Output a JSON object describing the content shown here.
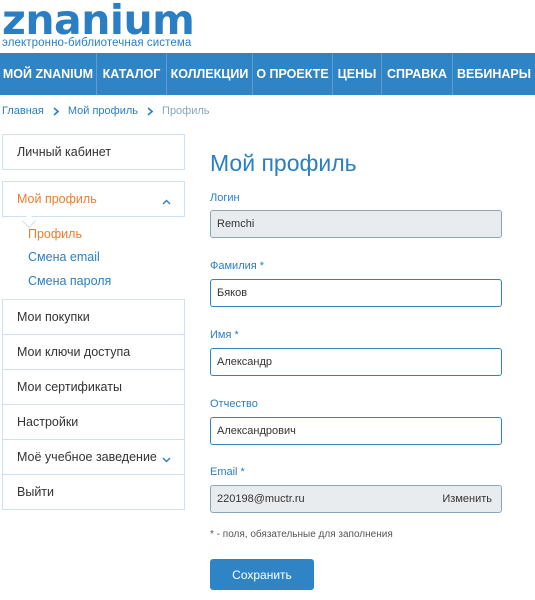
{
  "logo": {
    "word": "znanium",
    "subtitle": "электронно-библиотечная система"
  },
  "nav": {
    "items": [
      {
        "label": "МОЙ ZNANIUM"
      },
      {
        "label": "КАТАЛОГ"
      },
      {
        "label": "КОЛЛЕКЦИИ"
      },
      {
        "label": "О ПРОЕКТЕ"
      },
      {
        "label": "ЦЕНЫ"
      },
      {
        "label": "СПРАВКА"
      },
      {
        "label": "ВЕБИНАРЫ"
      }
    ]
  },
  "breadcrumb": {
    "items": [
      "Главная",
      "Мой профиль",
      "Профиль"
    ]
  },
  "sidebar": {
    "cabinet": "Личный кабинет",
    "profile": "Мой профиль",
    "profile_sub": [
      "Профиль",
      "Смена email",
      "Смена пароля"
    ],
    "items": [
      "Мои покупки",
      "Мои ключи доступа",
      "Мои сертификаты",
      "Настройки",
      "Моё учебное заведение",
      "Выйти"
    ]
  },
  "main": {
    "title": "Мой профиль",
    "login": {
      "label": "Логин",
      "value": "Remchi"
    },
    "surname": {
      "label": "Фамилия *",
      "value": "Бяков"
    },
    "name": {
      "label": "Имя *",
      "value": "Александр"
    },
    "patronymic": {
      "label": "Отчество",
      "value": "Александрович"
    },
    "email": {
      "label": "Email *",
      "value": "220198@muctr.ru",
      "action": "Изменить"
    },
    "note": "* - поля, обязательные для заполнения",
    "save": "Сохранить"
  },
  "colors": {
    "brand": "#2f84c6",
    "accent": "#ef7d2b",
    "border": "#cfe0ee"
  }
}
